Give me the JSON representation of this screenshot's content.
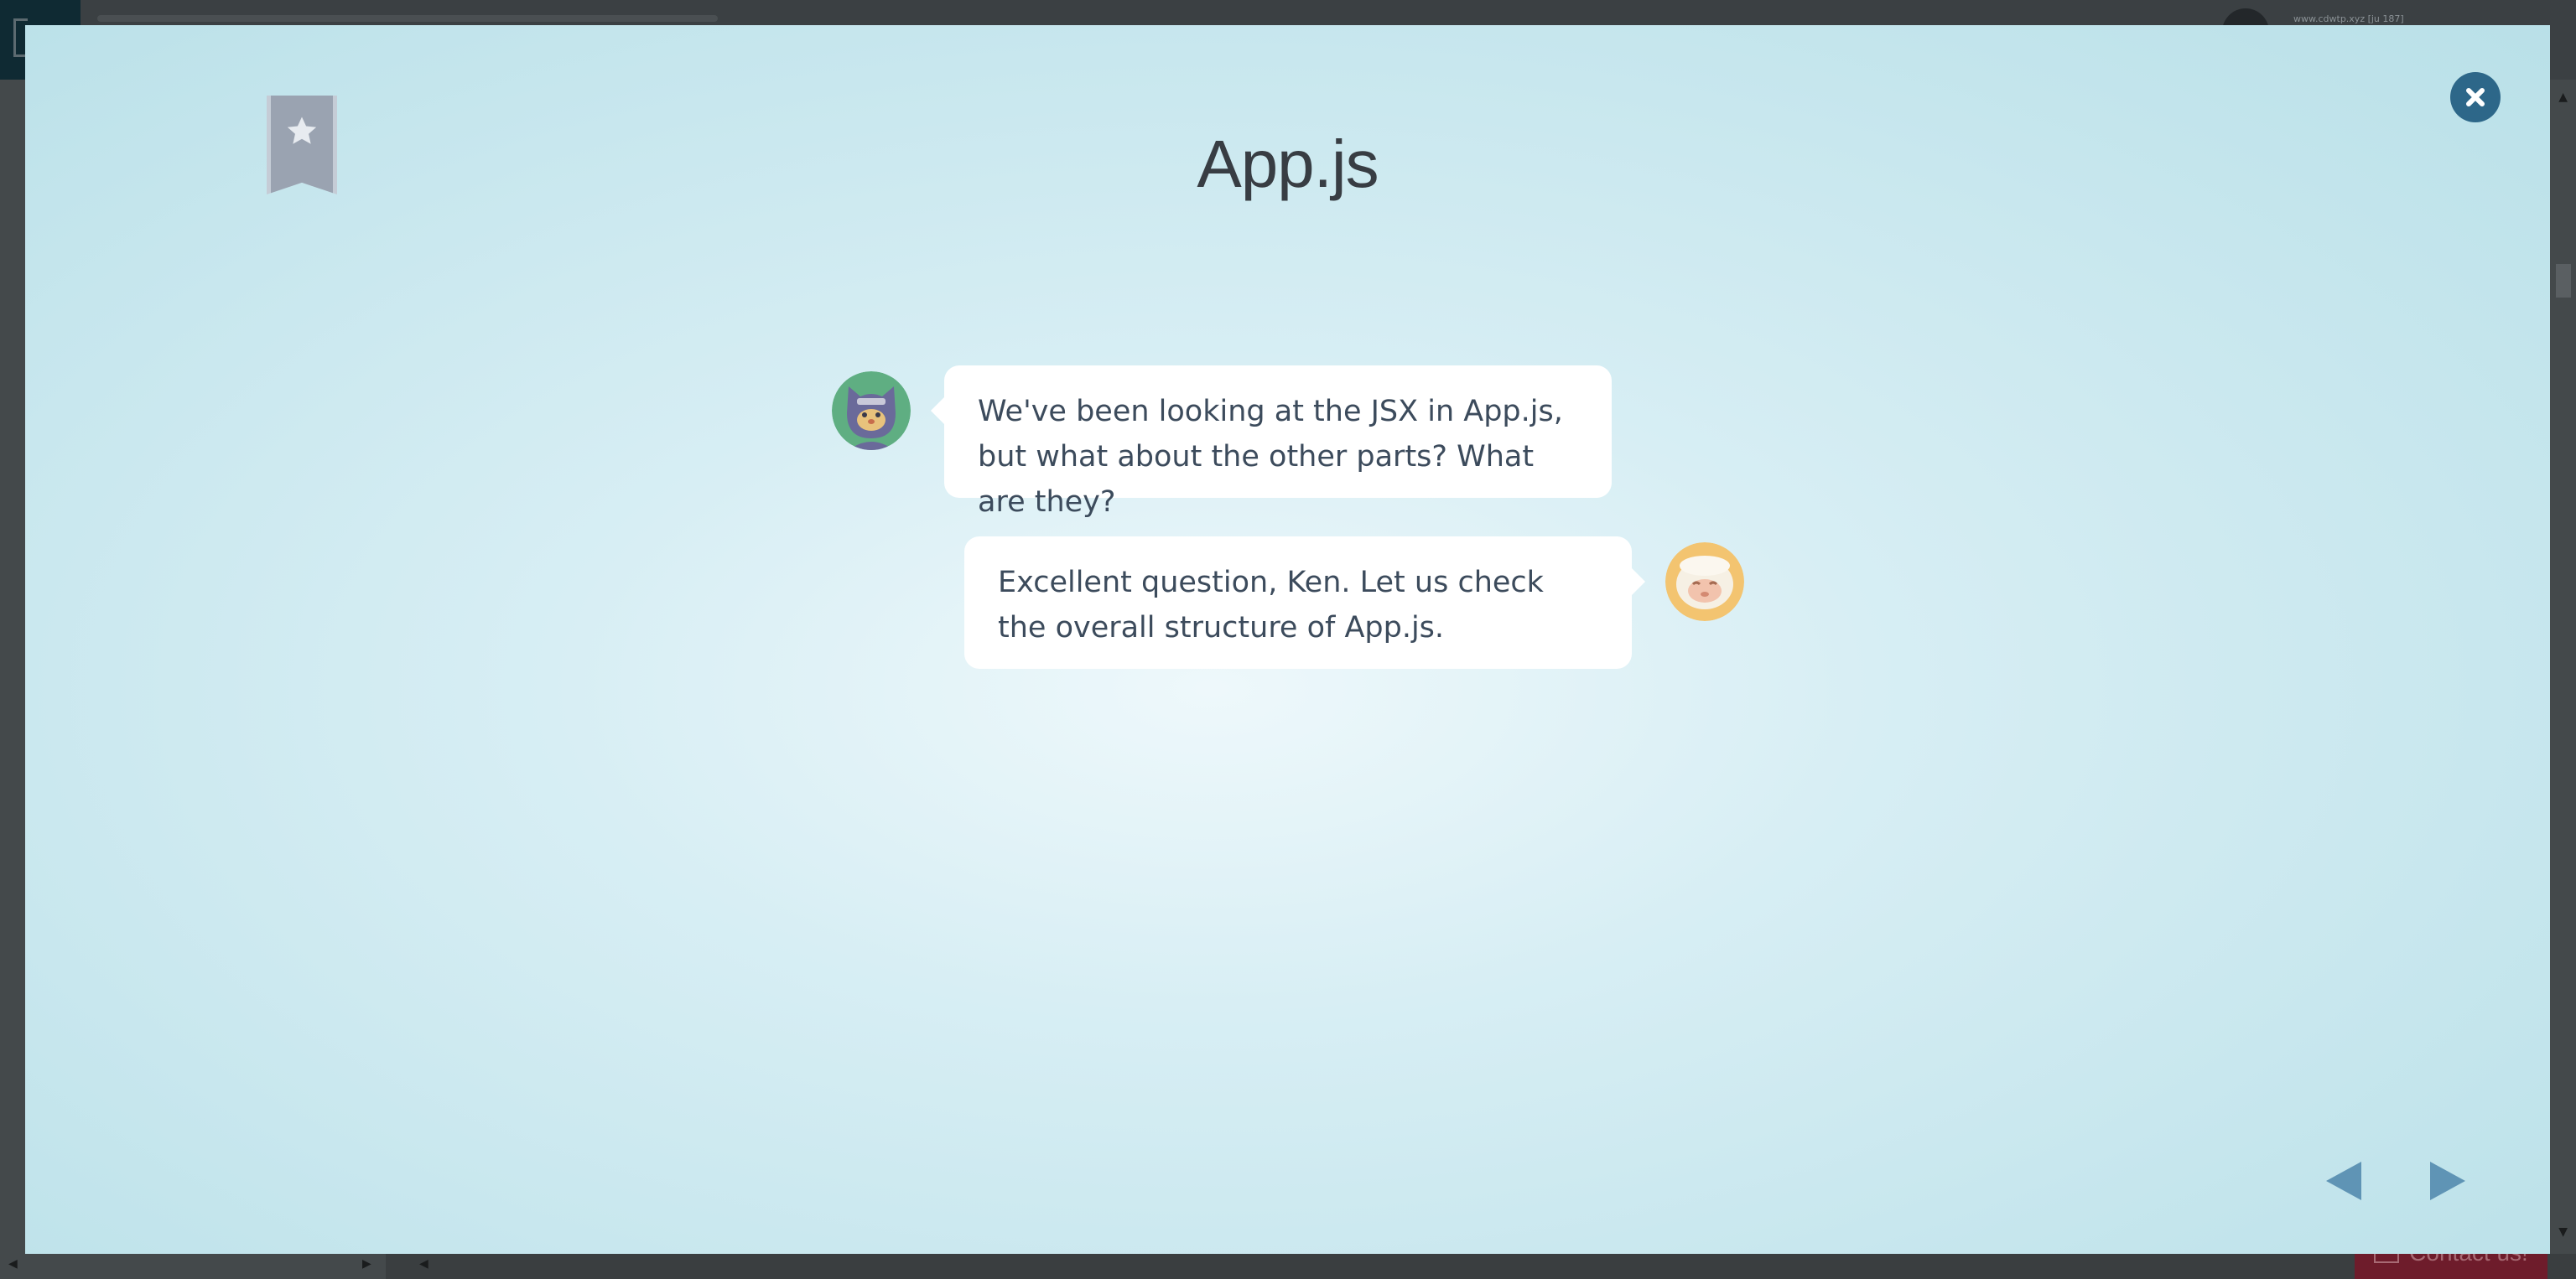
{
  "background": {
    "user_text": "www.cdwtp.xyz [ju 187]",
    "contact_label": "Contact us!"
  },
  "modal": {
    "title": "App.js",
    "messages": [
      {
        "speaker": "ken",
        "side": "left",
        "text": "We've been looking at the JSX in App.js, but what about the other parts? What are they?"
      },
      {
        "speaker": "teacher",
        "side": "right",
        "text": "Excellent question, Ken. Let us check the overall structure of App.js."
      }
    ]
  },
  "colors": {
    "close_button": "#2d6789",
    "nav_arrows": "#5f94b5",
    "bookmark": "#9aa3b1",
    "bubble_text": "#3c4b5c"
  },
  "icons": {
    "bookmark": "bookmark-star-icon",
    "close": "close-icon",
    "prev": "triangle-left-icon",
    "next": "triangle-right-icon"
  }
}
